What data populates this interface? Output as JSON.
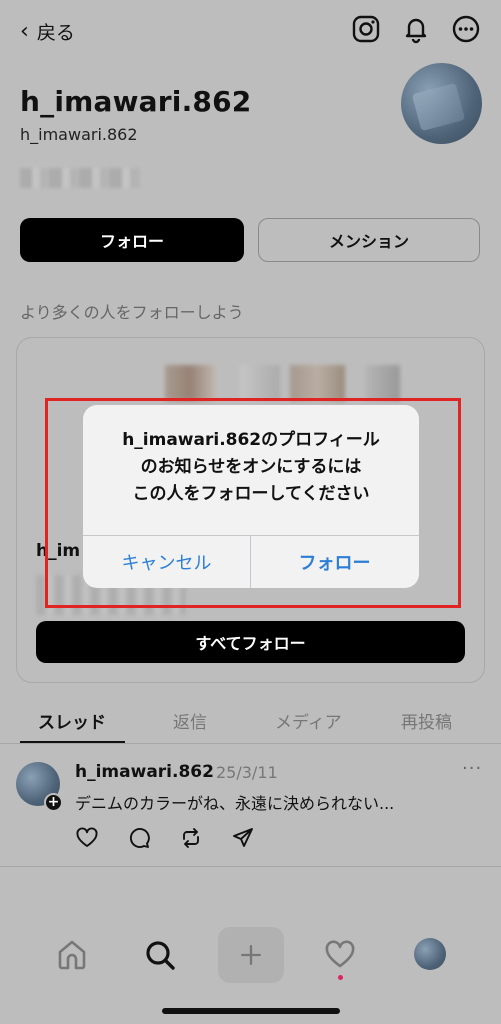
{
  "topbar": {
    "back_label": "戻る",
    "icons": [
      "instagram-icon",
      "bell-icon",
      "more-circle-icon"
    ]
  },
  "profile": {
    "display_name": "h_imawari.862",
    "handle": "h_imawari.862",
    "follow_label": "フォロー",
    "mention_label": "メンション"
  },
  "suggestions": {
    "title": "より多くの人をフォローしよう",
    "name_partial": "h_im",
    "follow_all_label": "すべてフォロー"
  },
  "tabs": [
    {
      "label": "スレッド",
      "active": true
    },
    {
      "label": "返信",
      "active": false
    },
    {
      "label": "メディア",
      "active": false
    },
    {
      "label": "再投稿",
      "active": false
    }
  ],
  "post": {
    "username": "h_imawari.862",
    "date": "25/3/11",
    "text": "デニムのカラーがね、永遠に決められない...",
    "more": "···"
  },
  "dialog": {
    "line1": "h_imawari.862のプロフィール",
    "line2": "のお知らせをオンにするには",
    "line3": "この人をフォローしてください",
    "cancel_label": "キャンセル",
    "confirm_label": "フォロー"
  },
  "colors": {
    "dialog_button": "#2d7fd6",
    "highlight": "#e02424",
    "notification_dot": "#e0245e"
  }
}
